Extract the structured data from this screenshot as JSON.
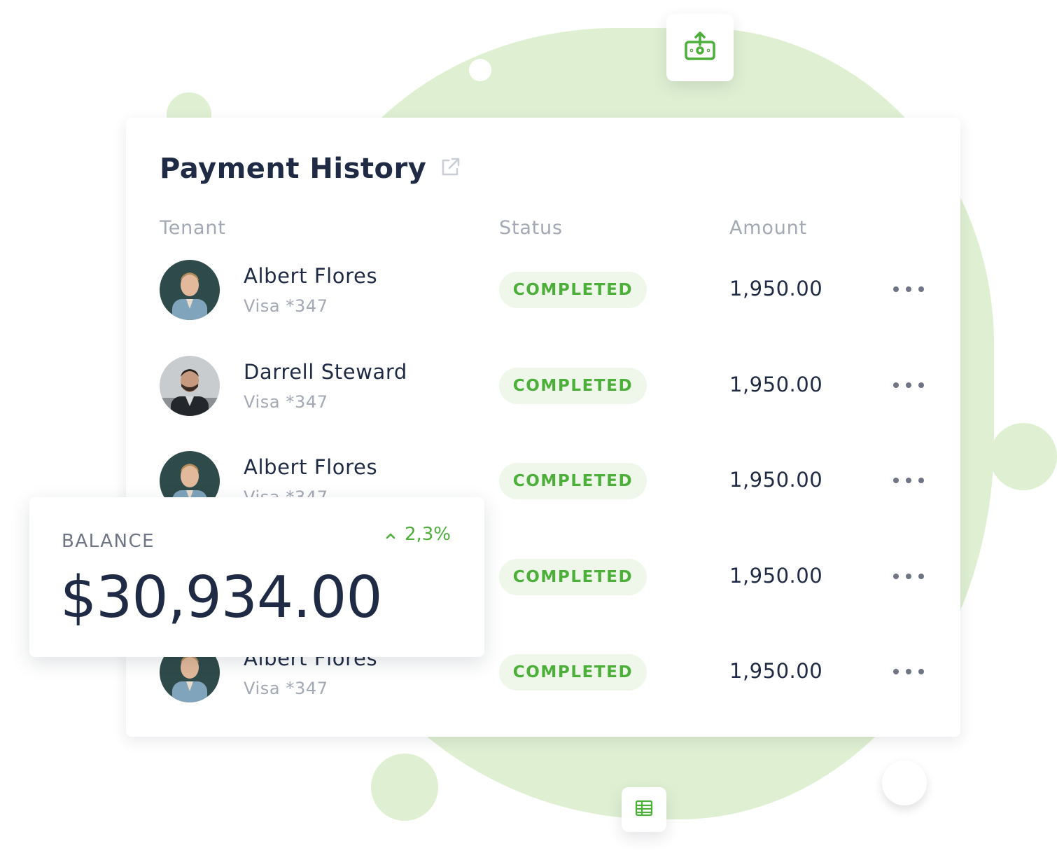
{
  "card": {
    "title": "Payment History",
    "columns": {
      "tenant": "Tenant",
      "status": "Status",
      "amount": "Amount"
    },
    "rows": [
      {
        "name": "Albert Flores",
        "card": "Visa *347",
        "status": "COMPLETED",
        "amount": "1,950.00"
      },
      {
        "name": "Darrell Steward",
        "card": "Visa *347",
        "status": "COMPLETED",
        "amount": "1,950.00"
      },
      {
        "name": "Albert Flores",
        "card": "Visa *347",
        "status": "COMPLETED",
        "amount": "1,950.00"
      },
      {
        "name": "",
        "card": "",
        "status": "COMPLETED",
        "amount": "1,950.00"
      },
      {
        "name": "Albert Flores",
        "card": "Visa *347",
        "status": "COMPLETED",
        "amount": "1,950.00"
      }
    ]
  },
  "balance": {
    "label": "BALANCE",
    "change": "2,3%",
    "value": "$30,934.00"
  },
  "icons": {
    "top_tile": "money-upload-icon",
    "bottom_tile": "spreadsheet-icon",
    "title_link": "external-link-icon",
    "row_menu": "more-horizontal-icon",
    "trend": "chevron-up-icon"
  },
  "colors": {
    "accent": "#4caf3a",
    "badge_bg": "#eef7e9",
    "text": "#1f2a44",
    "muted": "#a3a8b5",
    "blob": "#dff0d2"
  }
}
